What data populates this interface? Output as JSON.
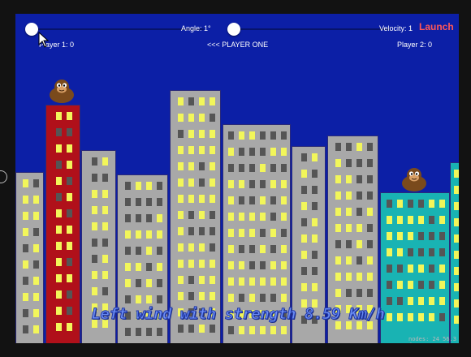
{
  "controls": {
    "angle_label": "Angle: 1°",
    "velocity_label": "Velocity: 1",
    "launch_label": "Launch",
    "angle_value": 1,
    "velocity_value": 1
  },
  "scoreboard": {
    "player1": "Player 1: 0",
    "player2": "Player 2: 0",
    "turn": "<<< PLAYER ONE"
  },
  "wind": {
    "text": "Left wind with strength 8.59 Km/h",
    "direction": "left",
    "strength_kmh": 8.59
  },
  "footer": {
    "fps_text": "nodes: 24  56.3 fps"
  },
  "colors": {
    "sky": "#0c1fa6",
    "lit_window": "#f2f65a",
    "dark_window": "#555555",
    "launch": "#ff5757"
  },
  "icons": {
    "gorilla": "gorilla-icon",
    "cursor": "mouse-pointer-icon"
  }
}
